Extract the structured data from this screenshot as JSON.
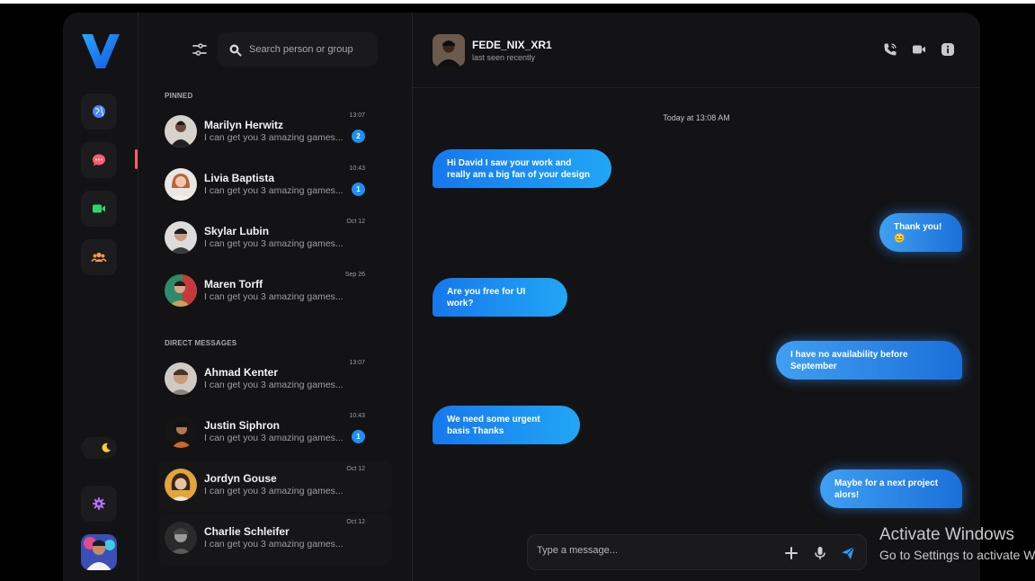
{
  "colors": {
    "accent": "#1e8ff5",
    "active": "#ff5c6c",
    "panel": "#131315"
  },
  "sidebar": {
    "nav": [
      {
        "icon": "globe-icon",
        "color": "#5b8ff9"
      },
      {
        "icon": "chat-icon",
        "color": "#ff5c6c"
      },
      {
        "icon": "video-icon",
        "color": "#2fd46d"
      },
      {
        "icon": "group-icon",
        "color": "#ff9f43"
      }
    ],
    "settings_icon": "gear-icon",
    "theme_icon": "moon-icon"
  },
  "list": {
    "search_placeholder": "Search person or group",
    "pinned_title": "PINNED",
    "direct_title": "DIRECT MESSAGES",
    "pinned": [
      {
        "name": "Marilyn Herwitz",
        "preview": "I can get you 3 amazing games...",
        "time": "13:07",
        "badge": "2"
      },
      {
        "name": "Livia Baptista",
        "preview": "I can get you 3 amazing games...",
        "time": "10:43",
        "badge": "1"
      },
      {
        "name": "Skylar Lubin",
        "preview": "I can get you 3 amazing games...",
        "time": "Oct 12",
        "badge": ""
      },
      {
        "name": "Maren Torff",
        "preview": "I can get you 3 amazing games...",
        "time": "Sep 26",
        "badge": ""
      }
    ],
    "direct": [
      {
        "name": "Ahmad Kenter",
        "preview": "I can get you 3 amazing games...",
        "time": "13:07",
        "badge": ""
      },
      {
        "name": "Justin Siphron",
        "preview": "I can get you 3 amazing games...",
        "time": "10:43",
        "badge": "1"
      },
      {
        "name": "Jordyn Gouse",
        "preview": "I can get you 3 amazing games...",
        "time": "Oct 12",
        "badge": ""
      },
      {
        "name": "Charlie Schleifer",
        "preview": "I can get you 3 amazing games...",
        "time": "Oct 12",
        "badge": ""
      }
    ]
  },
  "conversation": {
    "name": "FEDE_NIX_XR1",
    "status": "last seen recently",
    "day_label": "Today at 13:08 AM",
    "messages": [
      {
        "dir": "in",
        "text": "Hi David I saw your work and really am a big fan of your design"
      },
      {
        "dir": "out",
        "text": "Thank you! 😊"
      },
      {
        "dir": "in",
        "text": "Are you free for UI work?"
      },
      {
        "dir": "out",
        "text": "I have no availability before September"
      },
      {
        "dir": "in",
        "text": "We need some urgent basis Thanks"
      },
      {
        "dir": "out",
        "text": "Maybe for a next project alors!"
      }
    ],
    "composer_placeholder": "Type a message..."
  },
  "watermark": {
    "line1": "Activate Windows",
    "line2": "Go to Settings to activate Windows."
  }
}
